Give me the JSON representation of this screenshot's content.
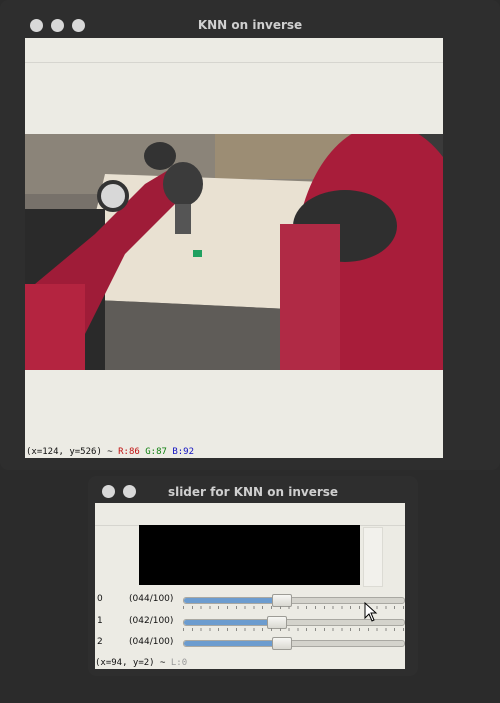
{
  "main_window": {
    "title": "KNN on inverse",
    "status": {
      "prefix": "(x=124, y=526) ~ ",
      "r": "R:86",
      "g": "G:87",
      "b": "B:92"
    }
  },
  "slider_window": {
    "title": "slider for KNN on inverse",
    "trackbars": [
      {
        "index": "0",
        "value_label": "(044/100)",
        "value": 44,
        "max": 100
      },
      {
        "index": "1",
        "value_label": "(042/100)",
        "value": 42,
        "max": 100
      },
      {
        "index": "2",
        "value_label": "(044/100)",
        "value": 44,
        "max": 100
      }
    ],
    "status": {
      "prefix": "(x=94, y=2) ~ ",
      "l": "L:0"
    }
  },
  "icons": {
    "window_buttons": "traffic-light-dots",
    "cursor": "mouse-pointer-icon"
  },
  "colors": {
    "accent_fill": "#6c9ccf",
    "robot_red": "#a81d3a"
  }
}
